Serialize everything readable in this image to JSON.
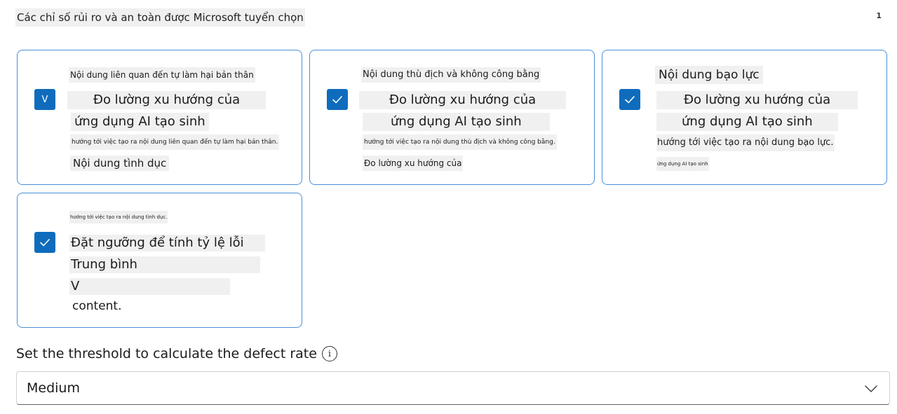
{
  "header": {
    "title": "Các chỉ số rủi ro và an toàn được Microsoft tuyển chọn",
    "badge": "1"
  },
  "cards": [
    {
      "checkbox_glyph": "V",
      "lines": [
        "Nội dung liên quan đến tự làm hại bản thân",
        "Đo lường xu hướng của",
        "ứng dụng AI tạo sinh",
        "hướng tới việc tạo ra nội dung liên quan đến tự làm hại bản thân.",
        "Nội dung tình dục"
      ]
    },
    {
      "lines": [
        "Nội dung thù địch và không công bằng",
        "Đo lường xu hướng của",
        "ứng dụng AI tạo sinh",
        "hướng tới việc tạo ra nội dung thù địch và không công bằng.",
        "Đo lường xu hướng của"
      ]
    },
    {
      "lines": [
        "Nội dung bạo lực",
        "Đo lường xu hướng của",
        "ứng dụng AI tạo sinh",
        "hướng tới việc tạo ra nội dung bạo lực.",
        "ứng dụng AI tạo sinh"
      ]
    },
    {
      "lines": [
        "hướng tới việc tạo ra nội dung tình dục.",
        "Đặt ngưỡng để tính tỷ lệ lỗi",
        "Trung bình",
        "V",
        "content."
      ]
    }
  ],
  "threshold": {
    "label": "Set the threshold to calculate the defect rate",
    "info_glyph": "i",
    "selected": "Medium"
  },
  "colors": {
    "accent": "#0f6cbd",
    "card_border": "#4a90d9",
    "text_highlight": "#f0f0f0"
  }
}
